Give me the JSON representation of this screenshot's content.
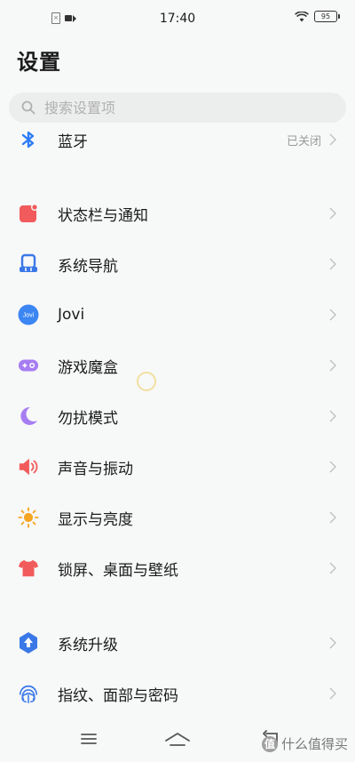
{
  "status_bar": {
    "time": "17:40",
    "battery": "95",
    "sim_glyph": "⨯"
  },
  "header": {
    "title": "设置"
  },
  "search": {
    "placeholder": "搜索设置项"
  },
  "settings": {
    "bluetooth": {
      "label": "蓝牙",
      "value": "已关闭",
      "icon": "bluetooth-icon",
      "color": "#2c7cf6"
    },
    "status_bar_notifications": {
      "label": "状态栏与通知",
      "icon": "notification-icon",
      "color": "#f25b5b"
    },
    "system_navigation": {
      "label": "系统导航",
      "icon": "navigation-icon",
      "color": "#3a78e8"
    },
    "jovi": {
      "label": "Jovi",
      "icon": "jovi-icon",
      "icon_text": "Jovi",
      "color": "#3b86f2"
    },
    "game_box": {
      "label": "游戏魔盒",
      "icon": "gamepad-icon",
      "color": "#a77df2"
    },
    "do_not_disturb": {
      "label": "勿扰模式",
      "icon": "moon-icon",
      "color": "#a77df2"
    },
    "sound_vibration": {
      "label": "声音与振动",
      "icon": "speaker-icon",
      "color": "#f25b5b"
    },
    "display_brightness": {
      "label": "显示与亮度",
      "icon": "sun-icon",
      "color": "#f7a623"
    },
    "lock_wallpaper": {
      "label": "锁屏、桌面与壁纸",
      "icon": "shirt-icon",
      "color": "#f25b5b"
    },
    "system_update": {
      "label": "系统升级",
      "icon": "update-icon",
      "color": "#3a78e8"
    },
    "fingerprint_face_password": {
      "label": "指纹、面部与密码",
      "icon": "fingerprint-icon",
      "color": "#3a78e8"
    }
  },
  "watermark": {
    "badge": "值",
    "text": "什么值得买"
  }
}
